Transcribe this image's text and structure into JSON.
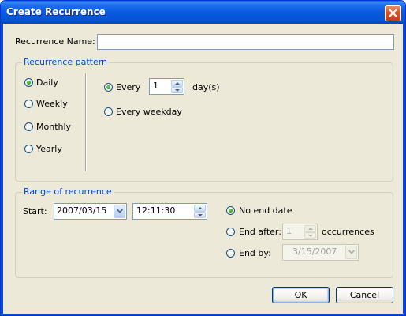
{
  "window": {
    "title": "Create Recurrence"
  },
  "recurrence_name": {
    "label": "Recurrence Name:",
    "value": ""
  },
  "pattern": {
    "group_title": "Recurrence pattern",
    "frequencies": [
      {
        "label": "Daily",
        "selected": true
      },
      {
        "label": "Weekly",
        "selected": false
      },
      {
        "label": "Monthly",
        "selected": false
      },
      {
        "label": "Yearly",
        "selected": false
      }
    ],
    "every_label": "Every",
    "every_value": "1",
    "days_unit": "day(s)",
    "every_weekday_label": "Every weekday",
    "selected_option": "every"
  },
  "range": {
    "group_title": "Range of recurrence",
    "start_label": "Start:",
    "start_date": "2007/03/15",
    "start_time": "12:11:30",
    "no_end_label": "No end date",
    "end_after_label": "End after:",
    "occurrences_value": "1",
    "occurrences_label": "occurrences",
    "end_by_label": "End by:",
    "end_by_date": "3/15/2007",
    "selected_option": "no_end"
  },
  "buttons": {
    "ok": "OK",
    "cancel": "Cancel"
  },
  "colors": {
    "title_bar": "#0a5ae0",
    "group_title": "#0046d5",
    "dialog_bg": "#ece9d8",
    "close_button": "#d6542d"
  },
  "icons": {
    "close": "close-icon",
    "dropdown": "chevron-down-icon",
    "spin_up": "spin-up-icon",
    "spin_down": "spin-down-icon"
  }
}
